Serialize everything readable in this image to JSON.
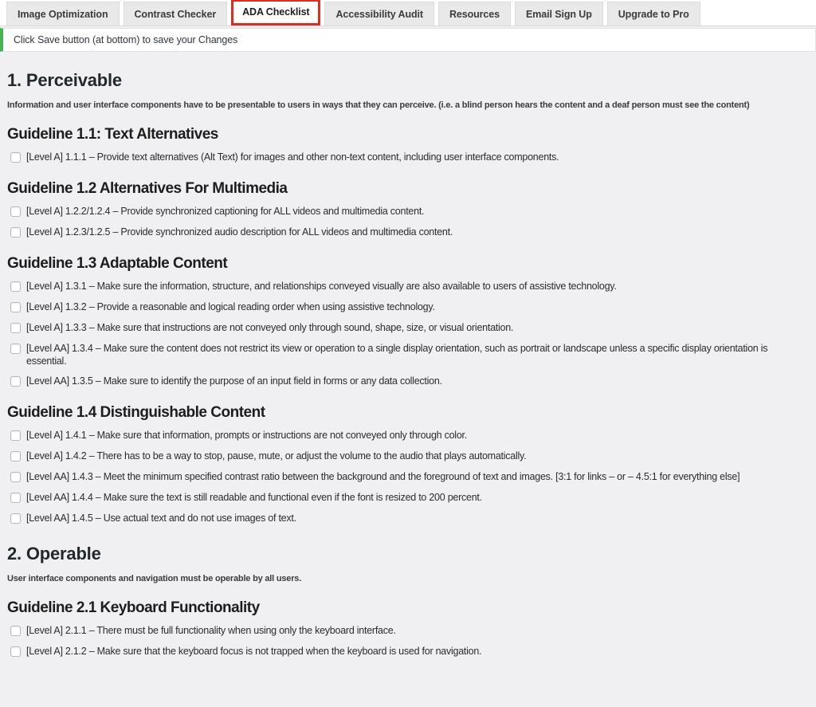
{
  "tabs": [
    {
      "label": "Image Optimization",
      "active": false
    },
    {
      "label": "Contrast Checker",
      "active": false
    },
    {
      "label": "ADA Checklist",
      "active": true
    },
    {
      "label": "Accessibility Audit",
      "active": false
    },
    {
      "label": "Resources",
      "active": false
    },
    {
      "label": "Email Sign Up",
      "active": false
    },
    {
      "label": "Upgrade to Pro",
      "active": false
    }
  ],
  "notice": {
    "text": "Click Save button (at bottom) to save your Changes",
    "accent_color": "#46b450"
  },
  "colors": {
    "active_tab_border": "#e02b20",
    "page_background": "#f0f0f2",
    "tab_background": "#e9e9e9"
  },
  "sections": [
    {
      "title": "1. Perceivable",
      "description": "Information and user interface components have to be presentable to users in ways that they can perceive. (i.e. a blind person hears the content and a deaf person must see the content)",
      "guidelines": [
        {
          "title": "Guideline 1.1: Text Alternatives",
          "items": [
            {
              "label": "[Level A] 1.1.1 – Provide text alternatives (Alt Text) for images and other non-text content, including user interface components.",
              "checked": false
            }
          ]
        },
        {
          "title": "Guideline 1.2 Alternatives For Multimedia",
          "items": [
            {
              "label": "[Level A] 1.2.2/1.2.4 – Provide synchronized captioning for ALL videos and multimedia content.",
              "checked": false
            },
            {
              "label": "[Level A] 1.2.3/1.2.5 – Provide synchronized audio description for ALL videos and multimedia content.",
              "checked": false
            }
          ]
        },
        {
          "title": "Guideline 1.3 Adaptable Content",
          "items": [
            {
              "label": "[Level A] 1.3.1 – Make sure the information, structure, and relationships conveyed visually are also available to users of assistive technology.",
              "checked": false
            },
            {
              "label": "[Level A] 1.3.2 – Provide a reasonable and logical reading order when using assistive technology.",
              "checked": false
            },
            {
              "label": "[Level A] 1.3.3 – Make sure that instructions are not conveyed only through sound, shape, size, or visual orientation.",
              "checked": false
            },
            {
              "label": "[Level AA] 1.3.4 – Make sure the content does not restrict its view or operation to a single display orientation, such as portrait or landscape unless a specific display orientation is essential.",
              "checked": false
            },
            {
              "label": "[Level AA] 1.3.5 – Make sure to identify the purpose of an input field in forms or any data collection.",
              "checked": false
            }
          ]
        },
        {
          "title": "Guideline 1.4 Distinguishable Content",
          "items": [
            {
              "label": "[Level A] 1.4.1 – Make sure that information, prompts or instructions are not conveyed only through color.",
              "checked": false
            },
            {
              "label": "[Level A] 1.4.2 – There has to be a way to stop, pause, mute, or adjust the volume to the audio that plays automatically.",
              "checked": false
            },
            {
              "label": "[Level AA] 1.4.3 – Meet the minimum specified contrast ratio between the background and the foreground of text and images. [3:1 for links – or – 4.5:1 for everything else]",
              "checked": false
            },
            {
              "label": "[Level AA] 1.4.4 – Make sure the text is still readable and functional even if the font is resized to 200 percent.",
              "checked": false
            },
            {
              "label": "[Level AA] 1.4.5 – Use actual text and do not use images of text.",
              "checked": false
            }
          ]
        }
      ]
    },
    {
      "title": "2. Operable",
      "description": "User interface components and navigation must be operable by all users.",
      "guidelines": [
        {
          "title": "Guideline 2.1 Keyboard Functionality",
          "items": [
            {
              "label": "[Level A] 2.1.1 – There must be full functionality when using only the keyboard interface.",
              "checked": false
            },
            {
              "label": "[Level A] 2.1.2 – Make sure that the keyboard focus is not trapped when the keyboard is used for navigation.",
              "checked": false
            }
          ]
        }
      ]
    }
  ]
}
